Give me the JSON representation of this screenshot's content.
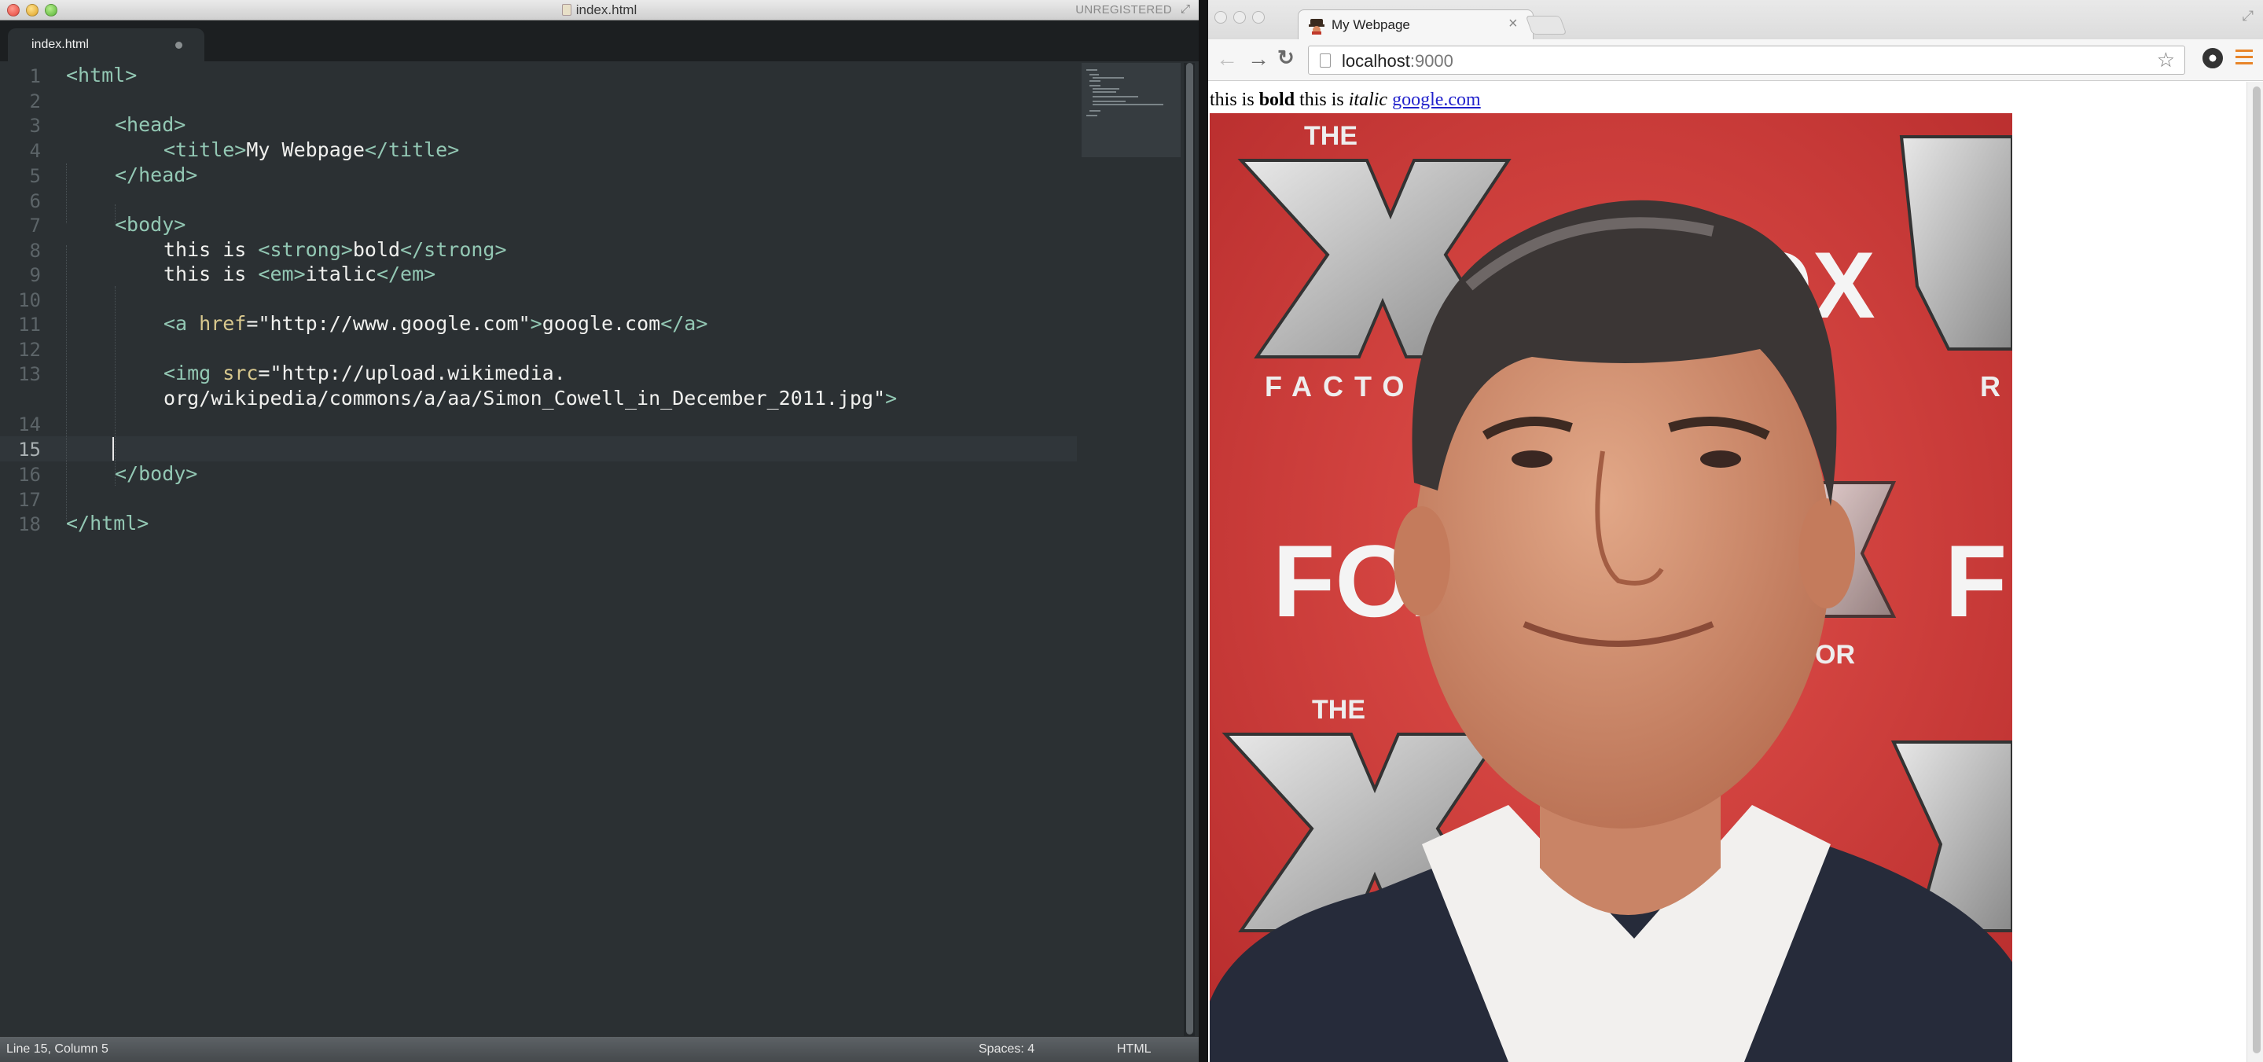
{
  "editor": {
    "window_title": "index.html",
    "unregistered": "UNREGISTERED",
    "tab_label": "index.html",
    "line_numbers": [
      "1",
      "2",
      "3",
      "4",
      "5",
      "6",
      "7",
      "8",
      "9",
      "10",
      "11",
      "12",
      "13",
      "",
      "14",
      "15",
      "16",
      "17",
      "18"
    ],
    "lines": {
      "l1": {
        "open": "<html>"
      },
      "l3": {
        "open": "<head>"
      },
      "l4": {
        "open": "<title>",
        "text": "My Webpage",
        "close": "</title>"
      },
      "l5": {
        "close": "</head>"
      },
      "l7": {
        "open": "<body>"
      },
      "l8": {
        "text": "this is ",
        "open": "<strong>",
        "inner": "bold",
        "close": "</strong>"
      },
      "l9": {
        "text": "this is ",
        "open": "<em>",
        "inner": "italic",
        "close": "</em>"
      },
      "l11": {
        "open": "<a ",
        "attr": "href",
        "eq": "=",
        "str": "\"http://www.google.com\"",
        "gt": ">",
        "inner": "google.com",
        "close": "</a>"
      },
      "l13a": {
        "open": "<img ",
        "attr": "src",
        "eq": "=",
        "str": "\"http://upload.wikimedia."
      },
      "l13b": {
        "str": "org/wikipedia/commons/a/aa/Simon_Cowell_in_December_2011.jpg\"",
        "gt": ">"
      },
      "l16": {
        "close": "</body>"
      },
      "l18": {
        "close": "</html>"
      }
    },
    "status": {
      "position": "Line 15, Column 5",
      "spaces": "Spaces: 4",
      "syntax": "HTML"
    }
  },
  "browser": {
    "tab_title": "My Webpage",
    "tab_close": "×",
    "url_host": "localhost",
    "url_port": ":9000",
    "nav": {
      "back": "←",
      "forward": "→",
      "reload": "C"
    },
    "star_icon": "☆",
    "page": {
      "text1": "this is ",
      "bold": "bold",
      "text2": " this is ",
      "italic": "italic",
      "link": "google.com"
    },
    "image_subject": "Simon Cowell in December 2011",
    "backdrop_texts": {
      "fox": "FOX",
      "the": "THE",
      "factor": "FACTOR",
      "factor_partial": "FACTO",
      "factor_tail": "OR"
    }
  },
  "colors": {
    "editor_bg": "#2b3033",
    "tag": "#93c8b4",
    "attribute": "#d8c88e",
    "link": "#2222cc",
    "menu_accent": "#e8852a",
    "backdrop_red": "#d83c3a"
  }
}
